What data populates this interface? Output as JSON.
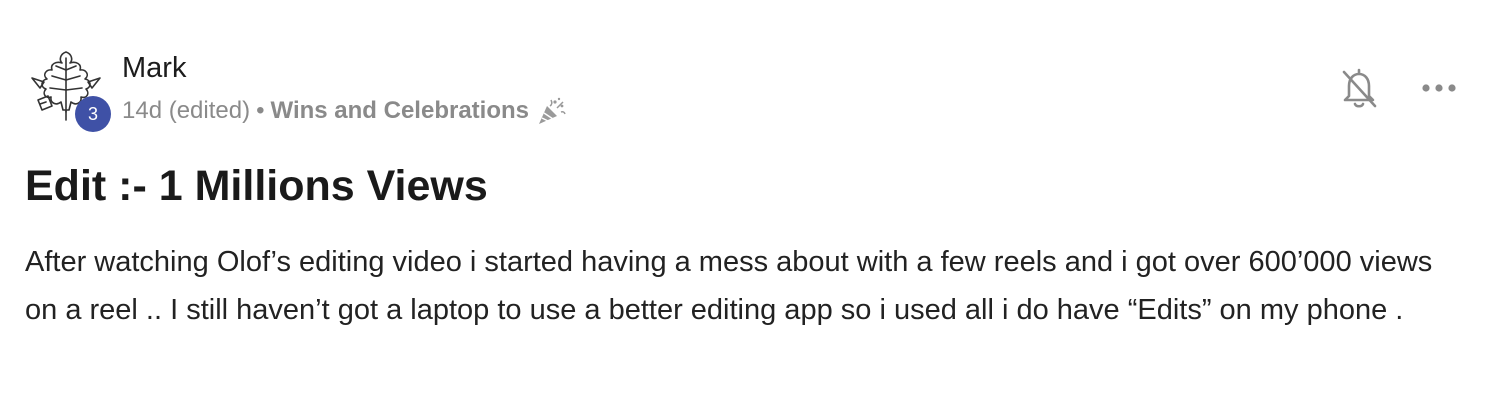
{
  "author": {
    "name": "Mark",
    "level": "3",
    "avatar_icon": "oak-leaf-logo-icon"
  },
  "meta": {
    "timestamp": "14d (edited)",
    "separator": "•",
    "category": "Wins and Celebrations",
    "category_icon": "party-popper-icon"
  },
  "actions": {
    "notifications_icon": "bell-off-icon",
    "more_icon": "more-dots-icon"
  },
  "post": {
    "title": "Edit :- 1 Millions Views",
    "body": "After watching Olof’s editing video i started having a mess about with a few reels and i got over 600’000 views on a reel .. I still haven’t got a laptop to use a better editing app so i used all i do have “Edits” on my phone ."
  },
  "colors": {
    "badge": "#3f51a6",
    "meta_text": "#8a8a8a",
    "title_text": "#1a1a1a"
  }
}
